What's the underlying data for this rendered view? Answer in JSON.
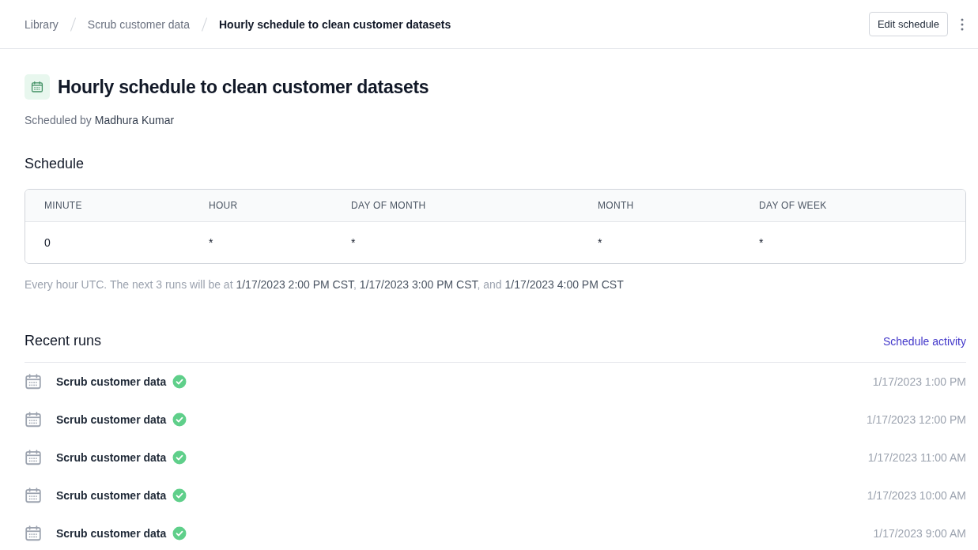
{
  "breadcrumbs": [
    {
      "label": "Library",
      "current": false
    },
    {
      "label": "Scrub customer data",
      "current": false
    },
    {
      "label": "Hourly schedule to clean customer datasets",
      "current": true
    }
  ],
  "actions": {
    "edit_button": "Edit schedule"
  },
  "header": {
    "title": "Hourly schedule to clean customer datasets",
    "subtitle": "Scheduled by **Madhura Kumar**"
  },
  "schedule": {
    "heading": "Schedule",
    "columns": [
      "MINUTE",
      "HOUR",
      "DAY OF MONTH",
      "MONTH",
      "DAY OF WEEK"
    ],
    "values": [
      "0",
      "*",
      "*",
      "*",
      "*"
    ],
    "note": "Every hour UTC. The next 3 runs will be at **1/17/2023 2:00 PM CST**, **1/17/2023 3:00 PM CST**, and **1/17/2023 4:00 PM CST**"
  },
  "recent_runs": {
    "heading": "Recent runs",
    "link": "Schedule activity",
    "rows": [
      {
        "name": "Scrub customer data",
        "kind": "success",
        "time": "1/17/2023 1:00 PM"
      },
      {
        "name": "Scrub customer data",
        "kind": "success",
        "time": "1/17/2023 12:00 PM"
      },
      {
        "name": "Scrub customer data",
        "kind": "success",
        "time": "1/17/2023 11:00 AM"
      },
      {
        "name": "Scrub customer data",
        "kind": "success",
        "time": "1/17/2023 10:00 AM"
      },
      {
        "name": "Scrub customer data",
        "kind": "success",
        "time": "1/17/2023 9:00 AM"
      }
    ]
  }
}
